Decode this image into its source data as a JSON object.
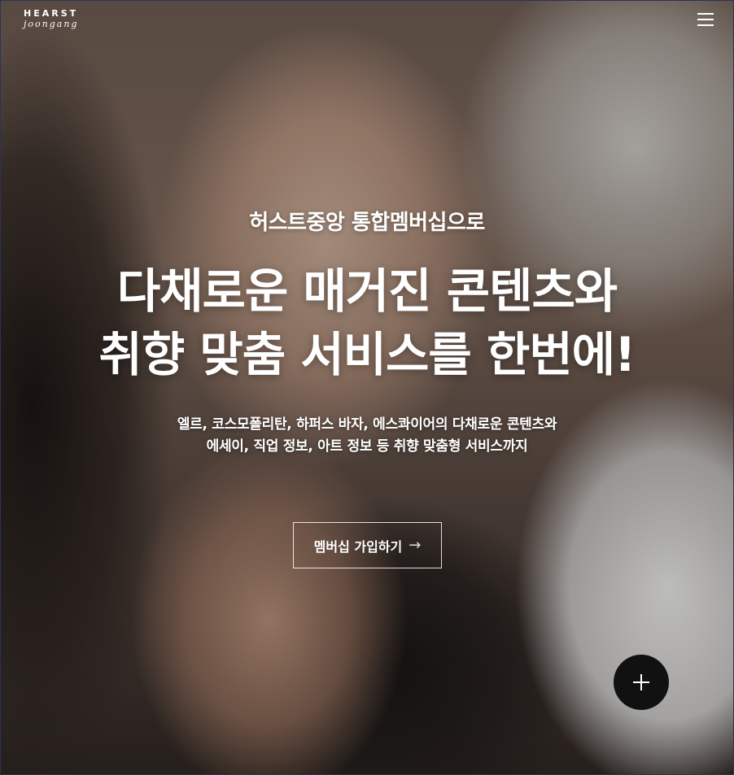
{
  "header": {
    "logo_top": "HEARST",
    "logo_bottom": "joongang",
    "menu_icon": "hamburger-menu-icon"
  },
  "hero": {
    "subtitle": "허스트중앙 통합멤버십으로",
    "headline_lines": [
      "다채로운 매거진 콘텐츠와",
      "취향 맞춤 서비스를 한번에!"
    ],
    "description_lines": [
      "엘르, 코스모폴리탄, 하퍼스 바자, 에스콰이어의 다채로운 콘텐츠와",
      "에세이, 직업 정보, 아트 정보 등 취향 맞춤형 서비스까지"
    ],
    "cta_label": "멤버십 가입하기",
    "cta_icon": "arrow-right-icon"
  },
  "fab": {
    "icon": "plus-icon"
  },
  "colors": {
    "text": "#ffffff",
    "fab_background": "#111111",
    "cta_border": "#ffffff"
  }
}
